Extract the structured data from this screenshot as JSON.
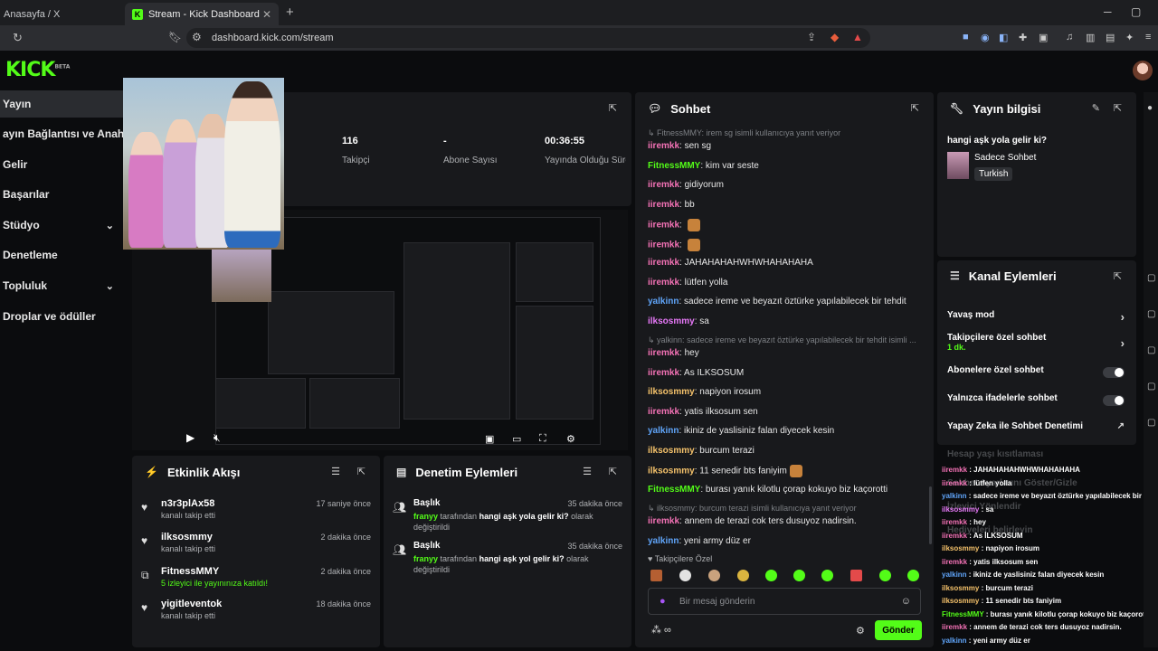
{
  "browser": {
    "inactive_tab": "Anasayfa / X",
    "active_tab": "Stream - Kick Dashboard",
    "url": "dashboard.kick.com/stream"
  },
  "app": {
    "logo": "KICK",
    "logo_badge": "BETA"
  },
  "sidebar": {
    "items": [
      {
        "label": "Yayın"
      },
      {
        "label": "ayın Bağlantısı ve Anahtarı"
      },
      {
        "label": "Gelir"
      },
      {
        "label": "Başarılar"
      },
      {
        "label": "Stüdyo"
      },
      {
        "label": "Denetleme"
      },
      {
        "label": "Topluluk"
      },
      {
        "label": "Droplar ve ödüller"
      }
    ]
  },
  "stats": [
    {
      "value": "116",
      "label": "Takipçi"
    },
    {
      "value": "-",
      "label": "Abone Sayısı"
    },
    {
      "value": "00:36:55",
      "label": "Yayında Olduğu Süre"
    }
  ],
  "activity": {
    "title": "Etkinlik Akışı",
    "items": [
      {
        "name": "n3r3plAx58",
        "sub": "kanalı takip etti",
        "time": "17 saniye önce",
        "icon": "heart-icon"
      },
      {
        "name": "ilksosmmy",
        "sub": "kanalı takip etti",
        "time": "2 dakika önce",
        "icon": "heart-icon"
      },
      {
        "name": "FitnessMMY",
        "sub": "5 izleyici ile yayınınıza katıldı!",
        "time": "2 dakika önce",
        "icon": "host-icon"
      },
      {
        "name": "yigitleventok",
        "sub": "kanalı takip etti",
        "time": "18 dakika önce",
        "icon": "heart-icon"
      }
    ]
  },
  "moderation": {
    "title": "Denetim Eylemleri",
    "items": [
      {
        "title": "Başlık",
        "user": "franyy",
        "mid": "tarafından",
        "value": "hangi aşk yola gelir ki?",
        "end": "olarak değiştirildi",
        "time": "35 dakika önce"
      },
      {
        "title": "Başlık",
        "user": "franyy",
        "mid": "tarafından",
        "value": "hangi aşk yol gelir ki?",
        "end": "olarak değiştirildi",
        "time": "35 dakika önce"
      }
    ]
  },
  "chat": {
    "title": "Sohbet",
    "messages": [
      {
        "type": "reply",
        "text": "FitnessMMY: irem sg isimli kullanıcıya yanıt veriyor"
      },
      {
        "user": "iiremkk",
        "color": "#f472b6",
        "text": "sen sg"
      },
      {
        "user": "FitnessMMY",
        "color": "#53fc18",
        "text": "kim var seste"
      },
      {
        "user": "iiremkk",
        "color": "#f472b6",
        "text": "gidiyorum"
      },
      {
        "user": "iiremkk",
        "color": "#f472b6",
        "text": "bb"
      },
      {
        "user": "iiremkk",
        "color": "#f472b6",
        "text": "",
        "emote": true
      },
      {
        "user": "iiremkk",
        "color": "#f472b6",
        "text": "",
        "emote": true
      },
      {
        "user": "iiremkk",
        "color": "#f472b6",
        "text": "JAHAHAHAHWHWHAHAHAHA"
      },
      {
        "user": "iiremkk",
        "color": "#f472b6",
        "text": "lütfen yolla"
      },
      {
        "user": "yalkinn",
        "color": "#60a5fa",
        "text": "sadece ireme ve beyazıt öztürke yapılabilecek bir tehdit"
      },
      {
        "user": "ilksosmmy",
        "color": "#e879f9",
        "text": "sa"
      },
      {
        "type": "reply",
        "text": "yalkinn: sadece ireme ve beyazıt öztürke yapılabilecek bir tehdit isimli ..."
      },
      {
        "user": "iiremkk",
        "color": "#f472b6",
        "text": "hey"
      },
      {
        "user": "iiremkk",
        "color": "#f472b6",
        "text": "As İLKSOSUM"
      },
      {
        "user": "ilksosmmy",
        "color": "#f5c26b",
        "text": "napiyon irosum"
      },
      {
        "user": "iiremkk",
        "color": "#f472b6",
        "text": "yatis ilksosum sen"
      },
      {
        "user": "yalkinn",
        "color": "#60a5fa",
        "text": "ikiniz de yaslisiniz falan diyecek kesin"
      },
      {
        "user": "ilksosmmy",
        "color": "#f5c26b",
        "text": "burcum terazi"
      },
      {
        "user": "ilksosmmy",
        "color": "#f5c26b",
        "text": "11 senedir bts faniyim",
        "emote": true
      },
      {
        "user": "FitnessMMY",
        "color": "#53fc18",
        "text": "burası yanık kilotlu çorap kokuyo biz kaçorotti"
      },
      {
        "type": "reply",
        "text": "ilksosmmy: burcum terazi isimli kullanıcıya yanıt veriyor"
      },
      {
        "user": "iiremkk",
        "color": "#f472b6",
        "text": "annem de terazi cok ters dusuyoz nadirsin."
      },
      {
        "user": "yalkinn",
        "color": "#60a5fa",
        "text": "yeni army düz er"
      }
    ],
    "followers_only": "Takipçilere Özel",
    "placeholder": "Bir mesaj gönderin",
    "send": "Gönder"
  },
  "stream_info": {
    "title_label": "Yayın bilgisi",
    "stream_title": "hangi aşk yola gelir ki?",
    "category": "Sadece Sohbet",
    "language": "Turkish"
  },
  "channel_actions": {
    "title": "Kanal Eylemleri",
    "slow_mode": "Yavaş mod",
    "followers_chat": "Takipçilere özel sohbet",
    "followers_chat_sub": "1 dk.",
    "subs_chat": "Abonelere özel sohbet",
    "emotes_chat": "Yalnızca ifadelerle sohbet",
    "ai_mod": "Yapay Zeka ile Sohbet Denetimi",
    "hidden_rows": [
      "Hesap yaşı kısıtlaması",
      "Sohbet Ayarlarını Göster/Gizle",
      "İzleyici Yönlendir",
      "Hediyeleri belirleyin"
    ]
  },
  "overlay_chat": [
    {
      "user": "iiremkk",
      "color": "#f472b6",
      "text": "JAHAHAHAHWHWHAHAHAHA"
    },
    {
      "user": "iiremkk",
      "color": "#f472b6",
      "text": "lütfen yolla"
    },
    {
      "user": "yalkinn",
      "color": "#60a5fa",
      "text": "sadece ireme ve beyazıt öztürke yapılabilecek bir tehdit"
    },
    {
      "user": "ilksosmmy",
      "color": "#e879f9",
      "text": "sa"
    },
    {
      "user": "iiremkk",
      "color": "#f472b6",
      "text": "hey"
    },
    {
      "user": "iiremkk",
      "color": "#f472b6",
      "text": "As İLKSOSUM"
    },
    {
      "user": "ilksosmmy",
      "color": "#f5c26b",
      "text": "napiyon irosum"
    },
    {
      "user": "iiremkk",
      "color": "#f472b6",
      "text": "yatis ilksosum sen"
    },
    {
      "user": "yalkinn",
      "color": "#60a5fa",
      "text": "ikiniz de yaslisiniz falan diyecek kesin"
    },
    {
      "user": "ilksosmmy",
      "color": "#f5c26b",
      "text": "burcum terazi"
    },
    {
      "user": "ilksosmmy",
      "color": "#f5c26b",
      "text": "11 senedir bts faniyim"
    },
    {
      "user": "FitnessMMY",
      "color": "#53fc18",
      "text": "burası yanık kilotlu çorap kokuyo biz kaçorotti"
    },
    {
      "user": "iiremkk",
      "color": "#f472b6",
      "text": "annem de terazi cok ters dusuyoz nadirsin."
    },
    {
      "user": "yalkinn",
      "color": "#60a5fa",
      "text": "yeni army düz er"
    }
  ],
  "colors": {
    "accent": "#53fc18",
    "panel": "#18191c",
    "bg": "#0b0c0e"
  }
}
